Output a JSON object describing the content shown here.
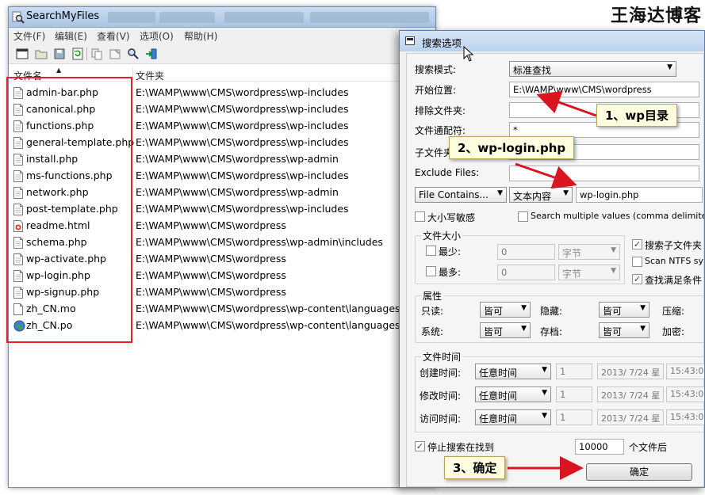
{
  "window": {
    "title": "SearchMyFiles"
  },
  "menu": [
    "文件(F)",
    "编辑(E)",
    "查看(V)",
    "选项(O)",
    "帮助(H)"
  ],
  "toolbar_icons": [
    "new-search-icon",
    "open-icon",
    "save-icon",
    "refresh-icon",
    "copy-icon",
    "properties-icon",
    "find-icon",
    "exit-icon"
  ],
  "columns": {
    "name": "文件名",
    "folder": "文件夹"
  },
  "files": [
    {
      "name": "admin-bar.php",
      "folder": "E:\\WAMP\\www\\CMS\\wordpress\\wp-includes",
      "icon": "doc"
    },
    {
      "name": "canonical.php",
      "folder": "E:\\WAMP\\www\\CMS\\wordpress\\wp-includes",
      "icon": "doc"
    },
    {
      "name": "functions.php",
      "folder": "E:\\WAMP\\www\\CMS\\wordpress\\wp-includes",
      "icon": "doc"
    },
    {
      "name": "general-template.php",
      "folder": "E:\\WAMP\\www\\CMS\\wordpress\\wp-includes",
      "icon": "doc"
    },
    {
      "name": "install.php",
      "folder": "E:\\WAMP\\www\\CMS\\wordpress\\wp-admin",
      "icon": "doc"
    },
    {
      "name": "ms-functions.php",
      "folder": "E:\\WAMP\\www\\CMS\\wordpress\\wp-includes",
      "icon": "doc"
    },
    {
      "name": "network.php",
      "folder": "E:\\WAMP\\www\\CMS\\wordpress\\wp-admin",
      "icon": "doc"
    },
    {
      "name": "post-template.php",
      "folder": "E:\\WAMP\\www\\CMS\\wordpress\\wp-includes",
      "icon": "doc"
    },
    {
      "name": "readme.html",
      "folder": "E:\\WAMP\\www\\CMS\\wordpress",
      "icon": "html"
    },
    {
      "name": "schema.php",
      "folder": "E:\\WAMP\\www\\CMS\\wordpress\\wp-admin\\includes",
      "icon": "doc"
    },
    {
      "name": "wp-activate.php",
      "folder": "E:\\WAMP\\www\\CMS\\wordpress",
      "icon": "doc"
    },
    {
      "name": "wp-login.php",
      "folder": "E:\\WAMP\\www\\CMS\\wordpress",
      "icon": "doc"
    },
    {
      "name": "wp-signup.php",
      "folder": "E:\\WAMP\\www\\CMS\\wordpress",
      "icon": "doc"
    },
    {
      "name": "zh_CN.mo",
      "folder": "E:\\WAMP\\www\\CMS\\wordpress\\wp-content\\languages",
      "icon": "blank"
    },
    {
      "name": "zh_CN.po",
      "folder": "E:\\WAMP\\www\\CMS\\wordpress\\wp-content\\languages",
      "icon": "globe"
    }
  ],
  "dialog": {
    "title": "搜索选项",
    "search_mode_label": "搜索模式:",
    "search_mode_value": "标准查找",
    "start_label": "开始位置:",
    "start_value": "E:\\WAMP\\www\\CMS\\wordpress",
    "exclude_folders_label": "排除文件夹:",
    "exclude_folders_value": "",
    "wildcard_label": "文件通配符:",
    "wildcard_value": "*",
    "subfolder_label": "子文件夹",
    "exclude_files_label": "Exclude Files:",
    "exclude_files_value": "",
    "contains_mode": "File Contains...",
    "content_type": "文本内容",
    "content_value": "wp-login.php",
    "case_sensitive_label": "大小写敏感",
    "multi_values_label": "Search multiple values (comma delimited)",
    "size_group_label": "文件大小",
    "min_label": "最少:",
    "max_label": "最多:",
    "min_value": "0",
    "max_value": "0",
    "size_unit": "字节",
    "search_subfolders_label": "搜索子文件夹",
    "scan_ntfs_label": "Scan NTFS sy",
    "match_all_label": "查找满足条件",
    "attr_group_label": "属性",
    "readonly_label": "只读:",
    "hidden_label": "隐藏:",
    "compressed_label": "压缩:",
    "system_label": "系统:",
    "archive_label": "存档:",
    "encrypted_label": "加密:",
    "attr_value": "皆可",
    "time_group_label": "文件时间",
    "created_label": "创建时间:",
    "modified_label": "修改时间:",
    "accessed_label": "访问时间:",
    "time_value": "任意时间",
    "time_count": "1",
    "date_value": "2013/ 7/24 星",
    "clock_value": "15:43:0",
    "stop_label": "停止搜索在找到",
    "stop_value": "10000",
    "stop_suffix": "个文件后",
    "ok_label": "确定"
  },
  "callouts": {
    "c1": "1、wp目录",
    "c2": "2、wp-login.php",
    "c3": "3、确定"
  },
  "watermark": "王海达博客",
  "colors": {
    "highlight_box": "#e3202b",
    "arrow": "#d9151f",
    "callout_bg": "#fffde0"
  }
}
